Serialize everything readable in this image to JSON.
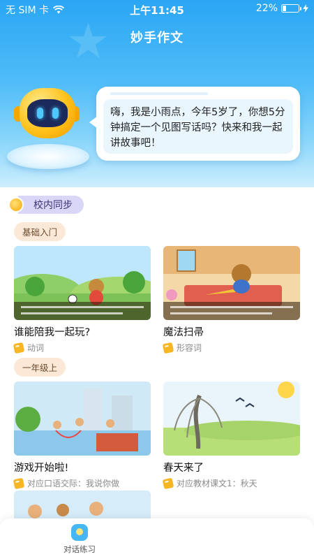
{
  "status_bar": {
    "carrier": "无 SIM 卡",
    "time": "上午11:45",
    "battery_percent": "22%",
    "battery_level": 0.22
  },
  "header": {
    "title": "妙手作文"
  },
  "assistant": {
    "message": "嗨，我是小雨点，今年5岁了，你想5分钟搞定一个见图写话吗？快来和我一起讲故事吧！"
  },
  "section": {
    "label": "校内同步"
  },
  "groups": [
    {
      "label": "基础入门",
      "cards": [
        {
          "title": "谁能陪我一起玩?",
          "tag": "动词"
        },
        {
          "title": "魔法扫帚",
          "tag": "形容词"
        }
      ]
    },
    {
      "label": "一年级上",
      "cards": [
        {
          "title": "游戏开始啦!",
          "tag": "对应口语交际：我说你做"
        },
        {
          "title": "春天来了",
          "tag": "对应教材课文1：秋天"
        }
      ]
    }
  ],
  "tabbar": {
    "items": [
      {
        "label": "对话练习"
      }
    ]
  },
  "colors": {
    "accent": "#2aa6f4",
    "section_chip": "#d9d6f7",
    "group_pill": "#fbe8d6"
  }
}
